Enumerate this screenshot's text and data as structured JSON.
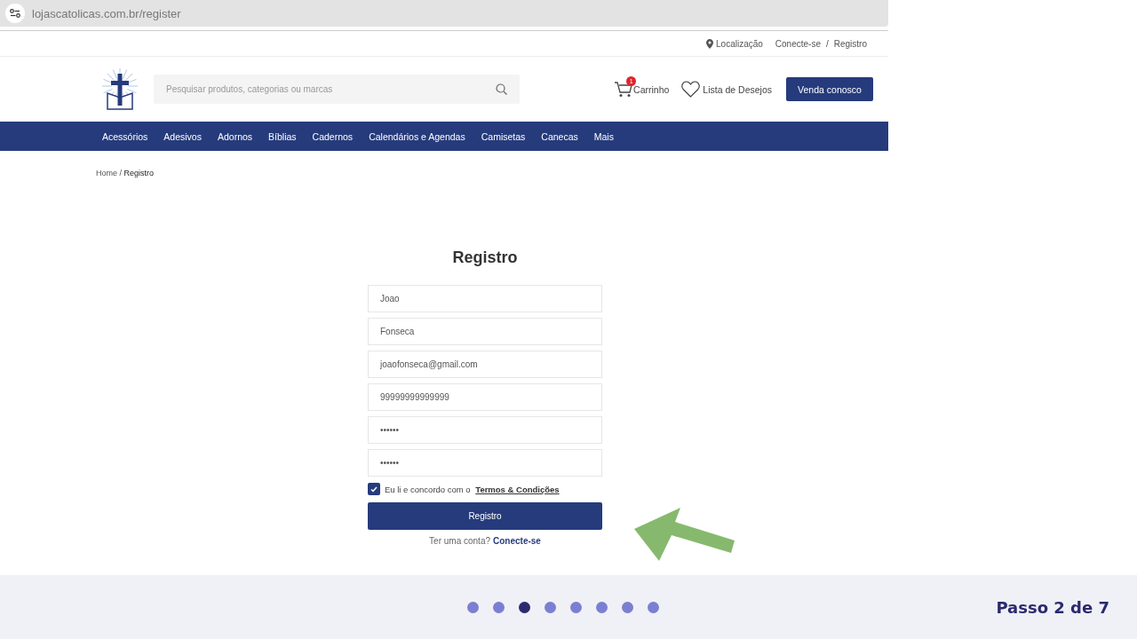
{
  "browser": {
    "url_host": "lojascatolicas.com.br",
    "url_path": "/register"
  },
  "top_links": {
    "location": "Localização",
    "login": "Conecte-se",
    "separator": "/",
    "register": "Registro"
  },
  "header": {
    "search_placeholder": "Pesquisar produtos, categorias ou marcas",
    "cart_label": "Carrinho",
    "cart_count": "1",
    "wishlist_label": "Lista de Desejos",
    "sell_button": "Venda conosco"
  },
  "nav": [
    "Acessórios",
    "Adesivos",
    "Adornos",
    "Bíblias",
    "Cadernos",
    "Calendários e Agendas",
    "Camisetas",
    "Canecas",
    "Mais"
  ],
  "breadcrumb": {
    "home": "Home",
    "separator": "/",
    "current": "Registro"
  },
  "form": {
    "title": "Registro",
    "fields": [
      {
        "value": "Joao"
      },
      {
        "value": "Fonseca"
      },
      {
        "value": "joaofonseca@gmail.com"
      },
      {
        "value": "99999999999999"
      },
      {
        "value": "••••••"
      },
      {
        "value": "••••••"
      }
    ],
    "terms": {
      "checked": true,
      "text": "Eu li e concordo com o",
      "link": "Termos & Condições"
    },
    "submit": "Registro",
    "login_prompt": "Ter uma conta?",
    "login_link": "Conecte-se"
  },
  "stepper": {
    "dots": [
      {
        "selected": false
      },
      {
        "selected": false
      },
      {
        "selected": true
      },
      {
        "selected": false
      },
      {
        "selected": false
      },
      {
        "selected": false
      },
      {
        "selected": false
      },
      {
        "selected": false
      }
    ],
    "label": "Passo 2 de 7"
  }
}
